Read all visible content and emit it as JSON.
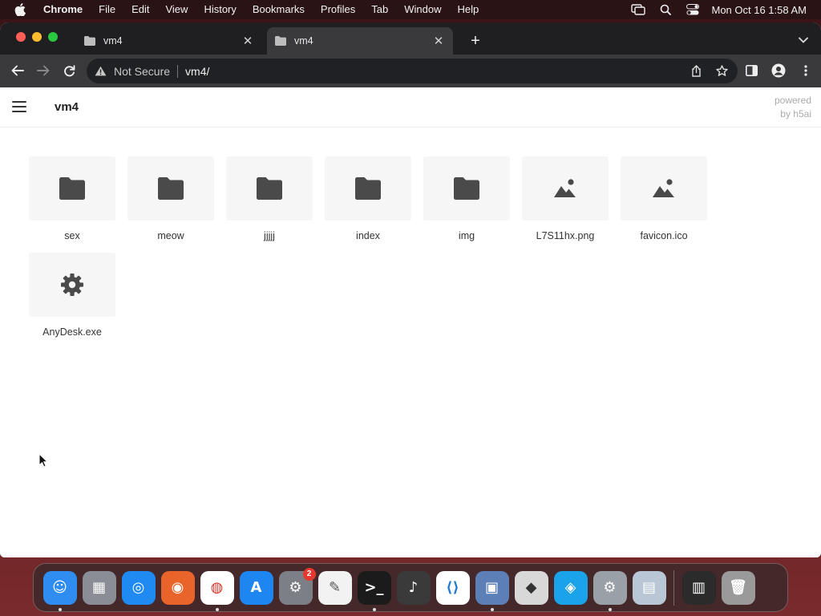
{
  "menubar": {
    "app_name": "Chrome",
    "items": [
      "File",
      "Edit",
      "View",
      "History",
      "Bookmarks",
      "Profiles",
      "Tab",
      "Window",
      "Help"
    ],
    "clock": "Mon Oct 16  1:58 AM"
  },
  "browser": {
    "tabs": [
      {
        "title": "vm4",
        "active": false
      },
      {
        "title": "vm4",
        "active": true
      }
    ],
    "address": {
      "security_label": "Not Secure",
      "url": "vm4/"
    }
  },
  "page": {
    "title": "vm4",
    "powered_line1": "powered",
    "powered_line2": "by h5ai",
    "items": [
      {
        "name": "sex",
        "type": "folder"
      },
      {
        "name": "meow",
        "type": "folder"
      },
      {
        "name": "jjjjj",
        "type": "folder"
      },
      {
        "name": "index",
        "type": "folder"
      },
      {
        "name": "img",
        "type": "folder"
      },
      {
        "name": "L7S11hx.png",
        "type": "image"
      },
      {
        "name": "favicon.ico",
        "type": "image"
      },
      {
        "name": "AnyDesk.exe",
        "type": "executable"
      }
    ]
  },
  "dock": {
    "apps": [
      {
        "name": "Finder",
        "icon": "finder-icon",
        "color": "#2f8cf0",
        "running": true
      },
      {
        "name": "Launchpad",
        "icon": "launchpad-icon",
        "color": "#8a8d96",
        "running": false
      },
      {
        "name": "Safari",
        "icon": "safari-icon",
        "color": "#1f8bf2",
        "running": false
      },
      {
        "name": "Firefox",
        "icon": "firefox-icon",
        "color": "#e8642a",
        "running": false
      },
      {
        "name": "Chrome",
        "icon": "chrome-icon",
        "color": "#ffffff",
        "running": true
      },
      {
        "name": "App Store",
        "icon": "app-store-icon",
        "color": "#1e86f0",
        "running": false
      },
      {
        "name": "System Preferences",
        "icon": "system-preferences-icon",
        "color": "#7d7f86",
        "running": false,
        "badge": "2"
      },
      {
        "name": "TextEdit",
        "icon": "textedit-icon",
        "color": "#f2f2f2",
        "running": false
      },
      {
        "name": "Terminal",
        "icon": "terminal-icon",
        "color": "#1b1b1b",
        "running": true
      },
      {
        "name": "GarageBand",
        "icon": "garageband-icon",
        "color": "#3a3a3a",
        "running": false
      },
      {
        "name": "Visual Studio Code",
        "icon": "vscode-icon",
        "color": "#ffffff",
        "running": false
      },
      {
        "name": "VirtualBox",
        "icon": "virtualbox-icon",
        "color": "#5c7fb8",
        "running": true
      },
      {
        "name": "Roblox",
        "icon": "roblox-icon",
        "color": "#d8d8d8",
        "running": false
      },
      {
        "name": "Roblox Studio",
        "icon": "roblox-studio-icon",
        "color": "#1aa3e8",
        "running": false
      },
      {
        "name": "System Settings",
        "icon": "system-settings-icon",
        "color": "#9aa0a8",
        "running": true
      },
      {
        "name": "Preview",
        "icon": "preview-icon",
        "color": "#b9c6d6",
        "running": false
      },
      {
        "name": "Activity Monitor",
        "icon": "activity-monitor-icon",
        "color": "#2b2b2b",
        "running": false
      },
      {
        "name": "Trash",
        "icon": "trash-icon",
        "color": "#9a9a9a",
        "running": false
      }
    ]
  }
}
